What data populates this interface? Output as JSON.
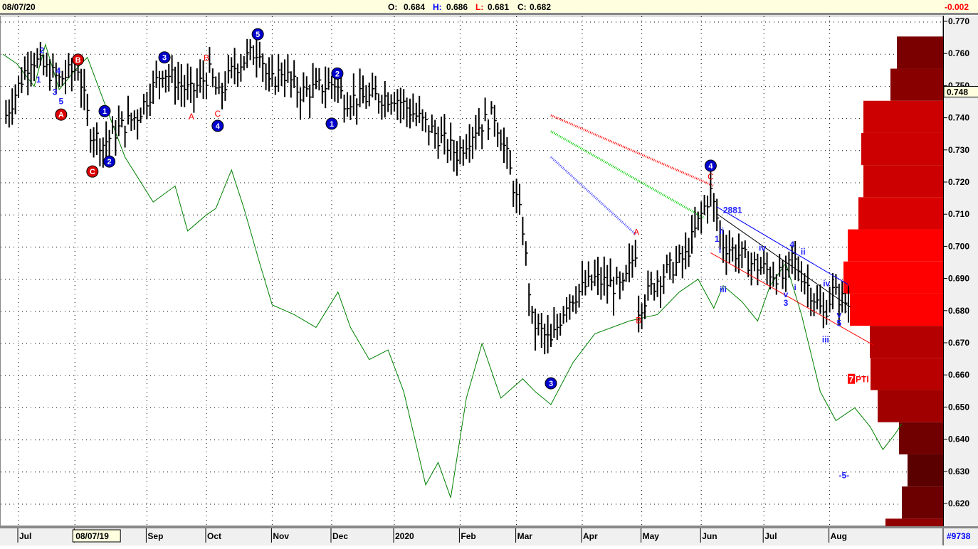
{
  "header": {
    "date": "08/07/20",
    "open_label": "O:",
    "open": "0.684",
    "high_label": "H:",
    "high": "0.686",
    "low_label": "L:",
    "low": "0.681",
    "close_label": "C:",
    "close": "0.682",
    "change": "-0.002"
  },
  "footer": {
    "months": [
      "Jul",
      "08/07/19",
      "Sep",
      "Oct",
      "Nov",
      "Dec",
      "2020",
      "Feb",
      "Mar",
      "Apr",
      "May",
      "Jun",
      "Jul",
      "Aug"
    ],
    "month_days": [
      5,
      23,
      46,
      65,
      86,
      105,
      125,
      146,
      164,
      185,
      204,
      223,
      243,
      264
    ],
    "symbol": "#9738"
  },
  "colors": {
    "up": "#000000",
    "green": "#008000",
    "red": "#ff0000",
    "blue": "#0000ff",
    "circle_blue": "#0000cc",
    "circle_red": "#dd0000"
  },
  "chart_data": {
    "type": "bar",
    "title": "",
    "xlabel": "",
    "ylabel": "",
    "ylim": [
      0.615,
      0.771
    ],
    "y_ticks": [
      "0.770",
      "0.760",
      "0.750",
      "0.740",
      "0.730",
      "0.720",
      "0.710",
      "0.700",
      "0.690",
      "0.680",
      "0.670",
      "0.660",
      "0.650",
      "0.640",
      "0.630",
      "0.620"
    ],
    "current_price_label": "0.748",
    "price_path": [
      [
        1,
        0.741
      ],
      [
        9,
        0.759
      ],
      [
        18,
        0.752
      ],
      [
        24,
        0.756
      ],
      [
        28,
        0.736
      ],
      [
        32,
        0.732
      ],
      [
        36,
        0.736
      ],
      [
        43,
        0.741
      ],
      [
        51,
        0.755
      ],
      [
        60,
        0.748
      ],
      [
        66,
        0.754
      ],
      [
        69,
        0.747
      ],
      [
        74,
        0.756
      ],
      [
        82,
        0.762
      ],
      [
        85,
        0.75
      ],
      [
        89,
        0.755
      ],
      [
        95,
        0.748
      ],
      [
        106,
        0.751
      ],
      [
        109,
        0.746
      ],
      [
        125,
        0.747
      ],
      [
        134,
        0.739
      ],
      [
        145,
        0.729
      ],
      [
        151,
        0.737
      ],
      [
        157,
        0.741
      ],
      [
        161,
        0.728
      ],
      [
        166,
        0.706
      ],
      [
        169,
        0.677
      ],
      [
        175,
        0.67
      ],
      [
        180,
        0.683
      ],
      [
        189,
        0.69
      ],
      [
        198,
        0.687
      ],
      [
        202,
        0.699
      ],
      [
        203,
        0.681
      ],
      [
        209,
        0.69
      ],
      [
        218,
        0.697
      ],
      [
        223,
        0.71
      ],
      [
        226,
        0.717
      ],
      [
        230,
        0.701
      ],
      [
        239,
        0.695
      ],
      [
        250,
        0.69
      ],
      [
        252,
        0.697
      ],
      [
        262,
        0.679
      ],
      [
        265,
        0.686
      ],
      [
        270,
        0.682
      ]
    ],
    "oscillator": [
      [
        0,
        0.76
      ],
      [
        4.5,
        0.757
      ],
      [
        10,
        0.75
      ],
      [
        13.6,
        0.763
      ],
      [
        18,
        0.749
      ],
      [
        23,
        0.755
      ],
      [
        27,
        0.759
      ],
      [
        32,
        0.746
      ],
      [
        39,
        0.728
      ],
      [
        48,
        0.714
      ],
      [
        55,
        0.719
      ],
      [
        59,
        0.705
      ],
      [
        65,
        0.71
      ],
      [
        68,
        0.712
      ],
      [
        73,
        0.724
      ],
      [
        77,
        0.712
      ],
      [
        82,
        0.695
      ],
      [
        86,
        0.682
      ],
      [
        93,
        0.679
      ],
      [
        100,
        0.675
      ],
      [
        107,
        0.686
      ],
      [
        111,
        0.675
      ],
      [
        117,
        0.665
      ],
      [
        123,
        0.668
      ],
      [
        128,
        0.655
      ],
      [
        135,
        0.626
      ],
      [
        139,
        0.633
      ],
      [
        143,
        0.622
      ],
      [
        148,
        0.653
      ],
      [
        153,
        0.67
      ],
      [
        159,
        0.653
      ],
      [
        166,
        0.659
      ],
      [
        170,
        0.655
      ],
      [
        175,
        0.651
      ],
      [
        182,
        0.664
      ],
      [
        189,
        0.673
      ],
      [
        200,
        0.677
      ],
      [
        209,
        0.679
      ],
      [
        216,
        0.686
      ],
      [
        222,
        0.69
      ],
      [
        227,
        0.681
      ],
      [
        230,
        0.688
      ],
      [
        236,
        0.683
      ],
      [
        241,
        0.677
      ],
      [
        245,
        0.688
      ],
      [
        250,
        0.695
      ],
      [
        255,
        0.679
      ],
      [
        261,
        0.655
      ],
      [
        266,
        0.646
      ],
      [
        272,
        0.65
      ],
      [
        277,
        0.644
      ],
      [
        281,
        0.637
      ],
      [
        285,
        0.642
      ],
      [
        287,
        0.645
      ]
    ],
    "moving_averages": [
      {
        "name": "red",
        "color": "#ff0000",
        "from": [
          175,
          0.741
        ],
        "to": [
          227,
          0.719
        ]
      },
      {
        "name": "green",
        "color": "#00cc00",
        "from": [
          175,
          0.736
        ],
        "to": [
          224,
          0.709
        ]
      },
      {
        "name": "blue",
        "color": "#4040ff",
        "from": [
          175,
          0.728
        ],
        "to": [
          202,
          0.704
        ]
      }
    ],
    "trendlines": [
      {
        "color": "#0000ff",
        "from": [
          228,
          0.7125
        ],
        "to": [
          270,
          0.6883
        ]
      },
      {
        "color": "#000000",
        "from": [
          228,
          0.7103
        ],
        "to": [
          270,
          0.6817
        ]
      },
      {
        "color": "#ff0000",
        "from": [
          226,
          0.6982
        ],
        "to": [
          278,
          0.6695
        ]
      }
    ],
    "volume_profile": {
      "centers": [
        0.7605,
        0.7505,
        0.7405,
        0.7305,
        0.7205,
        0.7105,
        0.7005,
        0.6905,
        0.6805,
        0.6705,
        0.6605,
        0.6505,
        0.6405,
        0.6305,
        0.6205,
        0.6105
      ],
      "volumes": [
        66,
        75,
        113,
        116,
        113,
        120,
        135,
        141,
        132,
        104,
        103,
        93,
        63,
        51,
        59,
        82
      ],
      "colors": [
        "#7a0000",
        "#880000",
        "#cc0000",
        "#cc0000",
        "#cc0000",
        "#d80000",
        "#ff0000",
        "#ff0000",
        "#ff0000",
        "#b40000",
        "#b80000",
        "#a00000",
        "#700000",
        "#5a0000",
        "#6c0000",
        "#900000"
      ]
    },
    "annotations": [
      {
        "t": 32.5,
        "p": 0.7423,
        "text": "1",
        "style": "bc"
      },
      {
        "t": 34,
        "p": 0.7266,
        "text": "2",
        "style": "bc"
      },
      {
        "t": 51.6,
        "p": 0.759,
        "text": "3",
        "style": "bc"
      },
      {
        "t": 68.6,
        "p": 0.7377,
        "text": "4",
        "style": "bc"
      },
      {
        "t": 81.4,
        "p": 0.7662,
        "text": "5",
        "style": "bc"
      },
      {
        "t": 105,
        "p": 0.7384,
        "text": "1",
        "style": "bc"
      },
      {
        "t": 106.8,
        "p": 0.754,
        "text": "2",
        "style": "bc"
      },
      {
        "t": 175,
        "p": 0.6576,
        "text": "3",
        "style": "bc"
      },
      {
        "t": 226,
        "p": 0.7253,
        "text": "4",
        "style": "bc"
      },
      {
        "t": 18.6,
        "p": 0.7412,
        "text": "A",
        "style": "rc"
      },
      {
        "t": 24,
        "p": 0.7583,
        "text": "B",
        "style": "rc"
      },
      {
        "t": 28.6,
        "p": 0.7235,
        "text": "C",
        "style": "rc"
      },
      {
        "t": 65,
        "p": 0.7588,
        "text": "B",
        "style": "r"
      },
      {
        "t": 60.2,
        "p": 0.7406,
        "text": "A",
        "style": "r"
      },
      {
        "t": 68.6,
        "p": 0.7415,
        "text": "C",
        "style": "r"
      },
      {
        "t": 202.3,
        "p": 0.7046,
        "text": "A",
        "style": "r"
      },
      {
        "t": 203,
        "p": 0.6772,
        "text": "B",
        "style": "r"
      },
      {
        "t": 226,
        "p": 0.7219,
        "text": "C",
        "style": "r"
      },
      {
        "t": 12.5,
        "p": 0.7612,
        "text": "2",
        "style": "b"
      },
      {
        "t": 17.7,
        "p": 0.7549,
        "text": "4",
        "style": "b"
      },
      {
        "t": 11.4,
        "p": 0.7521,
        "text": "1",
        "style": "b"
      },
      {
        "t": 16.6,
        "p": 0.7482,
        "text": "3",
        "style": "b"
      },
      {
        "t": 18.6,
        "p": 0.7453,
        "text": "5",
        "style": "b"
      },
      {
        "t": 233,
        "p": 0.7115,
        "text": "2881",
        "style": "b"
      },
      {
        "t": 229.5,
        "p": 0.705,
        "text": "ii",
        "style": "b"
      },
      {
        "t": 228,
        "p": 0.7025,
        "text": "1",
        "style": "b"
      },
      {
        "t": 229,
        "p": 0.699,
        "text": "i",
        "style": "b"
      },
      {
        "t": 230,
        "p": 0.6868,
        "text": "iii",
        "style": "b"
      },
      {
        "t": 242.5,
        "p": 0.6998,
        "text": "iv",
        "style": "b"
      },
      {
        "t": 252,
        "p": 0.7008,
        "text": "4",
        "style": "b"
      },
      {
        "t": 255.5,
        "p": 0.6985,
        "text": "ii",
        "style": "b"
      },
      {
        "t": 253,
        "p": 0.6875,
        "text": "i",
        "style": "b"
      },
      {
        "t": 250,
        "p": 0.6853,
        "text": "v",
        "style": "b"
      },
      {
        "t": 250,
        "p": 0.6826,
        "text": "3",
        "style": "b"
      },
      {
        "t": 263,
        "p": 0.6887,
        "text": "iv",
        "style": "b"
      },
      {
        "t": 262.7,
        "p": 0.6712,
        "text": "iii",
        "style": "b"
      },
      {
        "t": 267,
        "p": 0.679,
        "text": "v",
        "style": "b"
      },
      {
        "t": 267,
        "p": 0.6763,
        "text": "5",
        "style": "b"
      },
      {
        "t": 268.6,
        "p": 0.629,
        "text": "-5-",
        "style": "b"
      }
    ],
    "pti_label": {
      "t": 270,
      "p": 0.659,
      "number": "7",
      "text": "PTI"
    }
  }
}
